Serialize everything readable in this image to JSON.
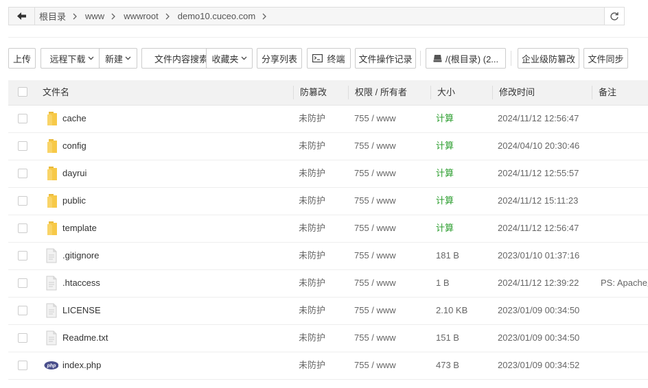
{
  "breadcrumb": {
    "items": [
      "根目录",
      "www",
      "wwwroot",
      "demo10.cuceo.com"
    ]
  },
  "toolbar": {
    "upload": "上传",
    "remote_download": "远程下载",
    "new": "新建",
    "content_search": "文件内容搜索",
    "favorites": "收藏夹",
    "share_list": "分享列表",
    "terminal": "终端",
    "op_log": "文件操作记录",
    "disk": "/(根目录) (2...",
    "tamper_proof": "企业级防篡改",
    "file_sync": "文件同步"
  },
  "table": {
    "headers": {
      "name": "文件名",
      "tamper": "防篡改",
      "perm": "权限 / 所有者",
      "size": "大小",
      "mtime": "修改时间",
      "note": "备注"
    },
    "rows": [
      {
        "name": "cache",
        "icon": "folder-icon",
        "tamper": "未防护",
        "perm": "755 / www",
        "size": "计算",
        "mtime": "2024/11/12 12:56:47",
        "note": ""
      },
      {
        "name": "config",
        "icon": "folder-icon",
        "tamper": "未防护",
        "perm": "755 / www",
        "size": "计算",
        "mtime": "2024/04/10 20:30:46",
        "note": ""
      },
      {
        "name": "dayrui",
        "icon": "folder-icon",
        "tamper": "未防护",
        "perm": "755 / www",
        "size": "计算",
        "mtime": "2024/11/12 12:55:57",
        "note": ""
      },
      {
        "name": "public",
        "icon": "folder-icon",
        "tamper": "未防护",
        "perm": "755 / www",
        "size": "计算",
        "mtime": "2024/11/12 15:11:23",
        "note": ""
      },
      {
        "name": "template",
        "icon": "folder-icon",
        "tamper": "未防护",
        "perm": "755 / www",
        "size": "计算",
        "mtime": "2024/11/12 12:56:47",
        "note": ""
      },
      {
        "name": ".gitignore",
        "icon": "file-icon",
        "tamper": "未防护",
        "perm": "755 / www",
        "size": "181 B",
        "mtime": "2023/01/10 01:37:16",
        "note": ""
      },
      {
        "name": ".htaccess",
        "icon": "file-icon",
        "tamper": "未防护",
        "perm": "755 / www",
        "size": "1 B",
        "mtime": "2024/11/12 12:39:22",
        "note": "PS: Apache用"
      },
      {
        "name": "LICENSE",
        "icon": "file-icon",
        "tamper": "未防护",
        "perm": "755 / www",
        "size": "2.10 KB",
        "mtime": "2023/01/09 00:34:50",
        "note": ""
      },
      {
        "name": "Readme.txt",
        "icon": "file-icon",
        "tamper": "未防护",
        "perm": "755 / www",
        "size": "151 B",
        "mtime": "2023/01/09 00:34:50",
        "note": ""
      },
      {
        "name": "index.php",
        "icon": "php-icon",
        "tamper": "未防护",
        "perm": "755 / www",
        "size": "473 B",
        "mtime": "2023/01/09 00:34:52",
        "note": ""
      }
    ]
  },
  "colors": {
    "calc_link": "#2c9e2f",
    "folder": "#f7c948",
    "php_badge": "#4a4f8c"
  }
}
